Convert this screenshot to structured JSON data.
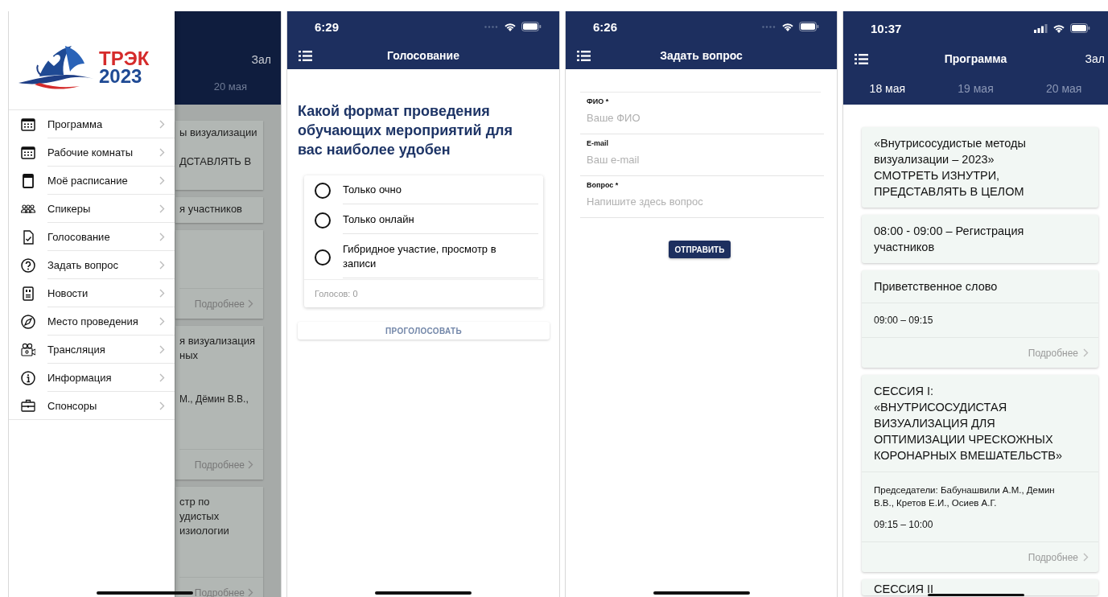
{
  "screens": [
    {
      "kind": "menu",
      "background": {
        "header_action": "Зал",
        "date_tab": "20 мая",
        "cards": [
          {
            "lines": [
              "ы визуализации",
              "ДСТАВЛЯТЬ В"
            ]
          },
          {
            "lines": [
              "я участников"
            ]
          },
          {
            "more": "Подробнее"
          },
          {
            "lines": [
              "я визуализация",
              "ных"
            ],
            "detail": "М., Дёмин В.В.,",
            "more": "Подробнее"
          },
          {
            "lines": [
              "стр по",
              "удистых",
              "изиологии"
            ],
            "more": "Подробнее"
          }
        ]
      },
      "drawer": {
        "logo": {
          "name": "ТРЭК",
          "year": "2023"
        },
        "items": [
          {
            "label": "Программа"
          },
          {
            "label": "Рабочие комнаты"
          },
          {
            "label": "Моё расписание"
          },
          {
            "label": "Спикеры"
          },
          {
            "label": "Голосование"
          },
          {
            "label": "Задать вопрос"
          },
          {
            "label": "Новости"
          },
          {
            "label": "Место проведения"
          },
          {
            "label": "Трансляция"
          },
          {
            "label": "Информация"
          },
          {
            "label": "Спонсоры"
          }
        ]
      }
    },
    {
      "kind": "poll",
      "status_time": "6:29",
      "title": "Голосование",
      "question": "Какой формат проведения обучающих мероприятий для вас наиболее удобен",
      "options": [
        {
          "label": "Только очно",
          "selected": false
        },
        {
          "label": "Только онлайн",
          "selected": false
        },
        {
          "label": "Гибридное участие, просмотр в записи",
          "selected": false
        }
      ],
      "votes": "Голосов: 0",
      "button": "ПРОГОЛОСОВАТЬ"
    },
    {
      "kind": "question",
      "status_time": "6:26",
      "title": "Задать вопрос",
      "fields": [
        {
          "label": "ФИО *",
          "placeholder": "Ваше ФИО"
        },
        {
          "label": "E-mail",
          "placeholder": "Ваш e-mail"
        },
        {
          "label": "Вопрос *",
          "placeholder": "Напишите здесь вопрос"
        }
      ],
      "button": "ОТПРАВИТЬ"
    },
    {
      "kind": "program",
      "status_time": "10:37",
      "title": "Программа",
      "header_action": "Зал",
      "tabs": [
        {
          "label": "18 мая",
          "selected": true
        },
        {
          "label": "19 мая",
          "selected": false
        },
        {
          "label": "20 мая",
          "selected": false
        }
      ],
      "cards": [
        {
          "title": "«Внутрисосудистые методы\nвизуализации – 2023»\nСМОТРЕТЬ ИЗНУТРИ,\nПРЕДСТАВЛЯТЬ В ЦЕЛОМ"
        },
        {
          "title": "08:00 - 09:00 – Регистрация\nучастников"
        },
        {
          "title": "Приветственное слово",
          "time": "09:00 – 09:15",
          "more": "Подробнее"
        },
        {
          "title": "СЕССИЯ I:\n«ВНУТРИСОСУДИСТАЯ\nВИЗУАЛИЗАЦИЯ ДЛЯ\nОПТИМИЗАЦИИ ЧРЕСКОЖНЫХ\nКОРОНАРНЫХ ВМЕШАТЕЛЬСТВ»",
          "detail": "Председатели: Бабунашвили А.М., Демин\nВ.В., Кретов Е.И., Осиев А.Г.",
          "time": "09:15 – 10:00",
          "more": "Подробнее"
        },
        {
          "title": "СЕССИЯ II"
        }
      ]
    }
  ]
}
